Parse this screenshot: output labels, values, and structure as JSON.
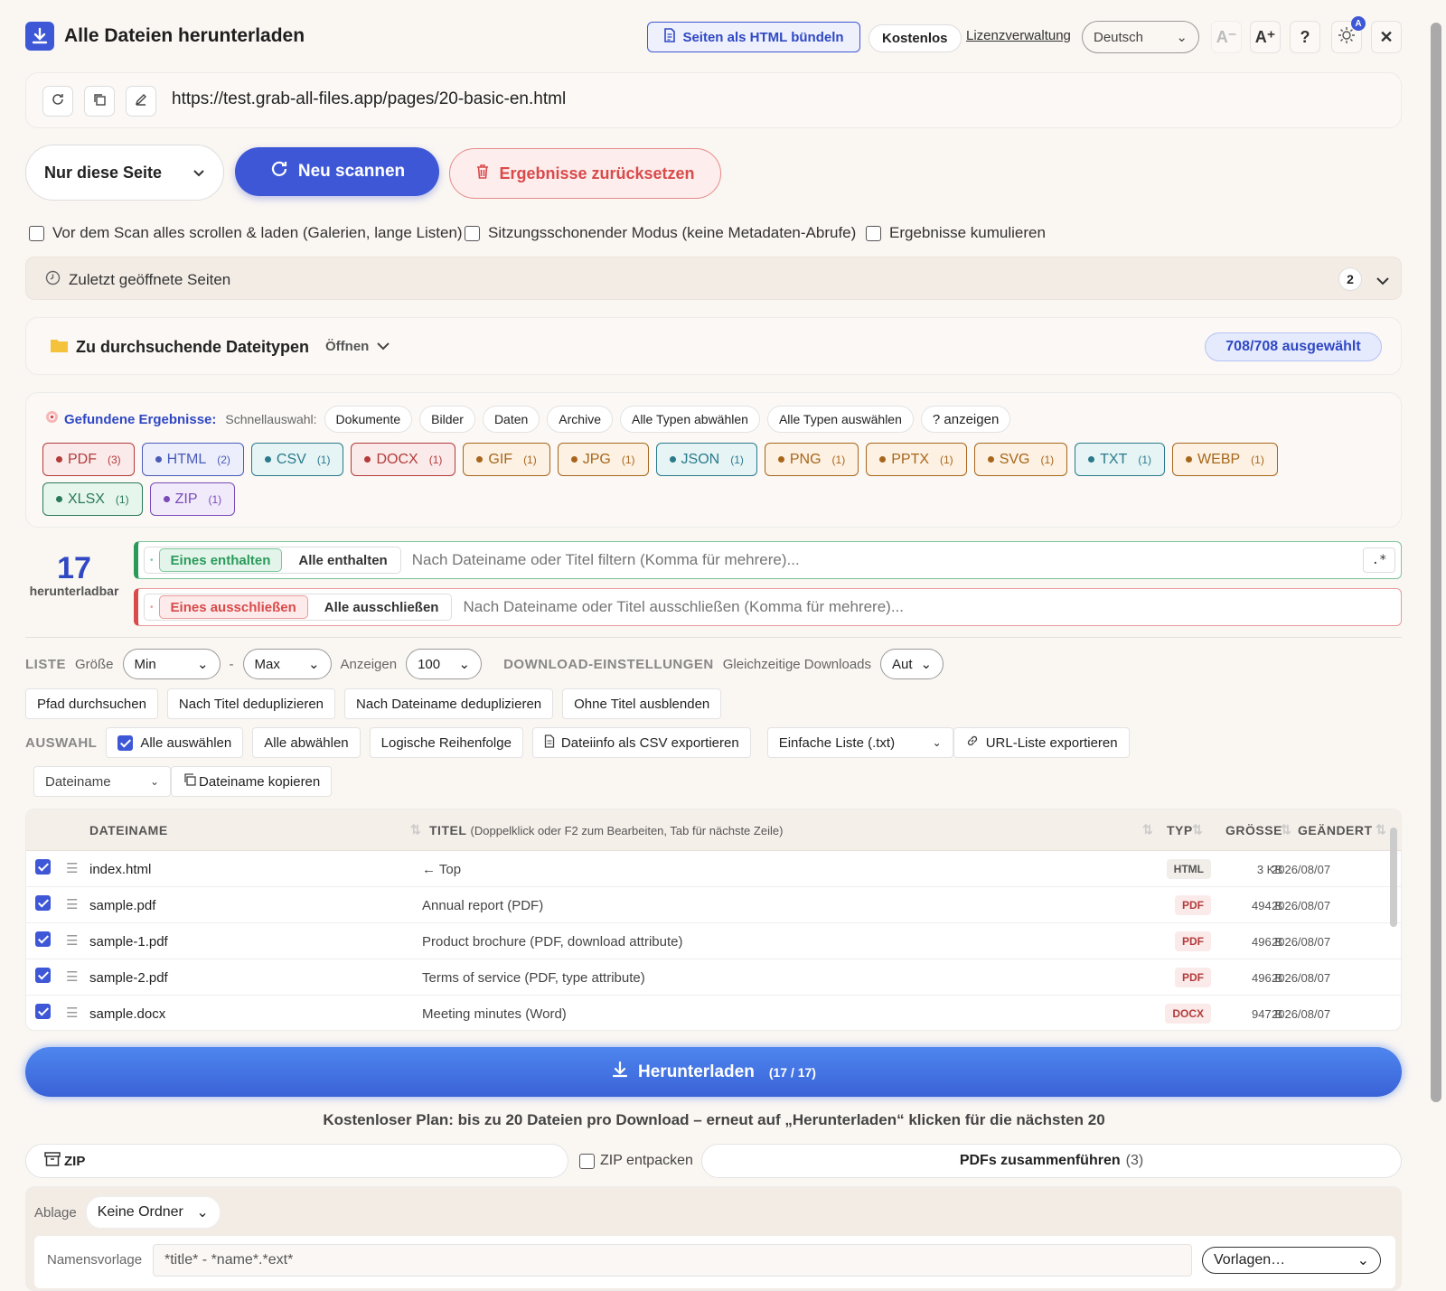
{
  "header": {
    "title": "Alle Dateien herunterladen",
    "bundle_label": "Seiten als HTML bündeln",
    "plan": "Kostenlos",
    "license": "Lizenzverwaltung",
    "language": "Deutsch",
    "font_smaller": "A⁻",
    "font_larger": "A⁺",
    "help": "?",
    "theme_badge": "A"
  },
  "url": "https://test.grab-all-files.app/pages/20-basic-en.html",
  "scan": {
    "scope": "Nur diese Seite",
    "rescan": "Neu scannen",
    "reset": "Ergebnisse zurücksetzen"
  },
  "options": [
    {
      "label": "Vor dem Scan alles scrollen & laden (Galerien, lange Listen)",
      "checked": false
    },
    {
      "label": "Sitzungsschonender Modus (keine Metadaten-Abrufe)",
      "checked": false
    },
    {
      "label": "Ergebnisse kumulieren",
      "checked": false
    }
  ],
  "recent": {
    "label": "Zuletzt geöffnete Seiten",
    "count": "2"
  },
  "filetypes": {
    "label": "Zu durchsuchende Dateitypen",
    "toggle": "Öffnen",
    "selected": "708/708 ausgewählt"
  },
  "results": {
    "label": "Gefundene Ergebnisse:",
    "quick_label": "Schnellauswahl:",
    "quick": [
      "Dokumente",
      "Bilder",
      "Daten",
      "Archive",
      "Alle Typen abwählen",
      "Alle Typen auswählen",
      "? anzeigen"
    ],
    "tags": [
      {
        "name": "PDF",
        "count": "(3)",
        "color": "#b33b3b",
        "bg": "#fbeaea"
      },
      {
        "name": "HTML",
        "count": "(2)",
        "color": "#4a5bb8",
        "bg": "#eceffb"
      },
      {
        "name": "CSV",
        "count": "(1)",
        "color": "#2a7a8a",
        "bg": "#e6f4f6"
      },
      {
        "name": "DOCX",
        "count": "(1)",
        "color": "#b33b3b",
        "bg": "#fbeaea"
      },
      {
        "name": "GIF",
        "count": "(1)",
        "color": "#a8661c",
        "bg": "#fcf1e2"
      },
      {
        "name": "JPG",
        "count": "(1)",
        "color": "#a8661c",
        "bg": "#fcf1e2"
      },
      {
        "name": "JSON",
        "count": "(1)",
        "color": "#2a7a8a",
        "bg": "#e6f4f6"
      },
      {
        "name": "PNG",
        "count": "(1)",
        "color": "#a8661c",
        "bg": "#fcf1e2"
      },
      {
        "name": "PPTX",
        "count": "(1)",
        "color": "#a8661c",
        "bg": "#fcf1e2"
      },
      {
        "name": "SVG",
        "count": "(1)",
        "color": "#a8661c",
        "bg": "#fcf1e2"
      },
      {
        "name": "TXT",
        "count": "(1)",
        "color": "#2a7a8a",
        "bg": "#e6f4f6"
      },
      {
        "name": "WEBP",
        "count": "(1)",
        "color": "#a8661c",
        "bg": "#fcf1e2"
      },
      {
        "name": "XLSX",
        "count": "(1)",
        "color": "#2a7a5a",
        "bg": "#e6f6ec"
      },
      {
        "name": "ZIP",
        "count": "(1)",
        "color": "#7a4ab8",
        "bg": "#f1eafb"
      }
    ]
  },
  "filter": {
    "count": "17",
    "count_label": "herunterladbar",
    "include_any": "Eines enthalten",
    "include_all": "Alle enthalten",
    "include_placeholder": "Nach Dateiname oder Titel filtern (Komma für mehrere)...",
    "regex": ".*",
    "exclude_any": "Eines ausschließen",
    "exclude_all": "Alle ausschließen",
    "exclude_placeholder": "Nach Dateiname oder Titel ausschließen (Komma für mehrere)..."
  },
  "list": {
    "heading": "LISTE",
    "size_label": "Größe",
    "min": "Min",
    "dash": "-",
    "max": "Max",
    "show_label": "Anzeigen",
    "show": "100",
    "dl_heading": "DOWNLOAD-EINSTELLUNGEN",
    "concurrent_label": "Gleichzeitige Downloads",
    "concurrent": "Aut",
    "buttons": [
      "Pfad durchsuchen",
      "Nach Titel deduplizieren",
      "Nach Dateiname deduplizieren",
      "Ohne Titel ausblenden"
    ]
  },
  "selection": {
    "heading": "AUSWAHL",
    "select_all": "Alle auswählen",
    "deselect_all": "Alle abwählen",
    "logical": "Logische Reihenfolge",
    "export_csv": "Dateiinfo als CSV exportieren",
    "list_format": "Einfache Liste (.txt)",
    "export_urls": "URL-Liste exportieren",
    "copy_field": "Dateiname",
    "copy_button": "Dateiname kopieren"
  },
  "table": {
    "headers": {
      "filename": "DATEINAME",
      "title": "TITEL",
      "title_hint": "(Doppelklick oder F2 zum Bearbeiten, Tab für nächste Zeile)",
      "type": "TYP",
      "size": "GRÖSSE",
      "modified": "GEÄNDERT"
    },
    "rows": [
      {
        "file": "index.html",
        "title": "← Top",
        "type": "HTML",
        "size": "3 KB",
        "date": "2026/08/07"
      },
      {
        "file": "sample.pdf",
        "title": "Annual report (PDF)",
        "type": "PDF",
        "size": "494 B",
        "date": "2026/08/07"
      },
      {
        "file": "sample-1.pdf",
        "title": "Product brochure (PDF, download attribute)",
        "type": "PDF",
        "size": "496 B",
        "date": "2026/08/07"
      },
      {
        "file": "sample-2.pdf",
        "title": "Terms of service (PDF, type attribute)",
        "type": "PDF",
        "size": "496 B",
        "date": "2026/08/07"
      },
      {
        "file": "sample.docx",
        "title": "Meeting minutes (Word)",
        "type": "DOCX",
        "size": "947 B",
        "date": "2026/08/07"
      }
    ]
  },
  "download": {
    "label": "Herunterladen",
    "count": "(17 / 17)",
    "note": "Kostenloser Plan: bis zu 20 Dateien pro Download – erneut auf „Herunterladen“ klicken für die nächsten 20",
    "zip": "ZIP",
    "unzip": "ZIP entpacken",
    "merge": "PDFs zusammenführen",
    "merge_count": "(3)"
  },
  "template": {
    "storage_label": "Ablage",
    "storage": "Keine Ordner",
    "name_label": "Namensvorlage",
    "name_value": "*title* - *name*.*ext*",
    "presets": "Vorlagen…"
  },
  "colors": {
    "accent": "#3d57d6",
    "danger": "#d94a4a",
    "success": "#2a9a5a"
  }
}
